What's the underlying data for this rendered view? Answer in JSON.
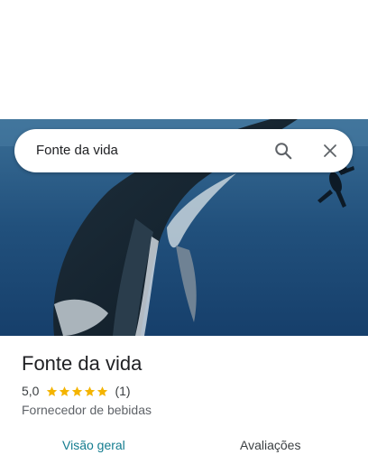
{
  "search": {
    "query": "Fonte da vida"
  },
  "place": {
    "title": "Fonte da vida",
    "rating": "5,0",
    "stars": 5,
    "review_count": "(1)",
    "category": "Fornecedor de bebidas"
  },
  "tabs": [
    {
      "label": "Visão geral"
    },
    {
      "label": "Avaliações"
    }
  ],
  "colors": {
    "star": "#f4b400",
    "active_tab": "#137c8f",
    "hero_water": "#1e4a78"
  },
  "icons": {
    "search": "search-icon",
    "close": "close-icon",
    "star": "star-icon"
  }
}
